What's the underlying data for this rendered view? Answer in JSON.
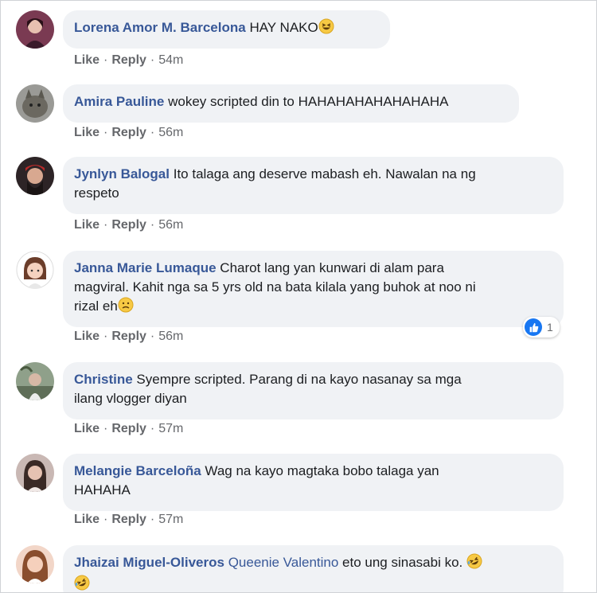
{
  "comments": [
    {
      "author": "Lorena Amor M. Barcelona",
      "text": "HAY NAKO",
      "time": "54m"
    },
    {
      "author": "Amira Pauline",
      "text": "wokey scripted din to HAHAHAHAHAHAHAHA",
      "time": "56m"
    },
    {
      "author": "Jynlyn Balogal",
      "text_line1": "Ito talaga ang deserve mabash eh. Nawalan na ng",
      "text_line2": "respeto",
      "time": "56m"
    },
    {
      "author": "Janna Marie Lumaque",
      "text_line1": "Charot lang yan kunwari di alam para",
      "text_line2": "magviral. Kahit nga sa 5 yrs old na bata kilala yang buhok at noo ni",
      "text_line3": "rizal eh",
      "time": "56m",
      "reaction_count": "1"
    },
    {
      "author": "Christine",
      "text_line1": "Syempre scripted. Parang di na kayo nasanay sa mga",
      "text_line2": "ilang vlogger diyan",
      "time": "57m"
    },
    {
      "author": "Melangie Barceloña",
      "text_line1": "Wag na kayo magtaka bobo talaga yan",
      "text_line2": "HAHAHA",
      "time": "57m"
    },
    {
      "author": "Jhaizai Miguel-Oliveros",
      "tag": "Queenie Valentino",
      "text": "eto ung sinasabi ko."
    }
  ],
  "actions": {
    "like": "Like",
    "reply": "Reply",
    "sep": "·"
  },
  "colors": {
    "link": "#385898",
    "bubble": "#f0f2f5",
    "meta": "#65676b",
    "like_blue": "#1877f2"
  },
  "icons": {
    "laugh": "grinning-squinting-face",
    "rofl": "rolling-on-floor-laughing",
    "sad": "confused-face",
    "like": "thumbs-up-icon"
  }
}
